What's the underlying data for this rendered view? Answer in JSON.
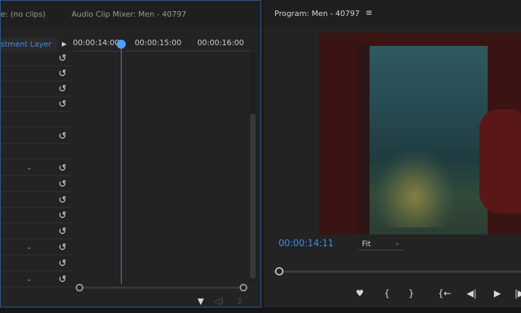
{
  "left_panel": {
    "effect_tab_label": "e: (no clips)",
    "mixer_tab_label": "Audio Clip Mixer: Men - 40797",
    "clip_name": "stment Layer",
    "play_arrow": "▶",
    "timecodes": [
      "00:00:14:00",
      "00:00:15:00",
      "00:00:16:00"
    ],
    "reset_icon": "↺",
    "dropdown_chevron": "⌄"
  },
  "right_panel": {
    "title": "Program: Men - 40797",
    "menu_icon": "≡",
    "timecode": "00:00:14:11",
    "fit_label": "Fit",
    "fit_chevron": "⌄"
  },
  "bottom_icons": {
    "filter": "▼",
    "audio": "◁)",
    "export": "⇪"
  },
  "transport": {
    "marker": "♥",
    "in_point": "{",
    "out_point": "}",
    "go_to_in": "{←",
    "step_back": "◀|",
    "play": "▶",
    "step_forward": "|▶"
  },
  "colors": {
    "accent_blue": "#3d8ee6",
    "panel_bg": "#232323",
    "video_border_red": "#3a1313"
  }
}
